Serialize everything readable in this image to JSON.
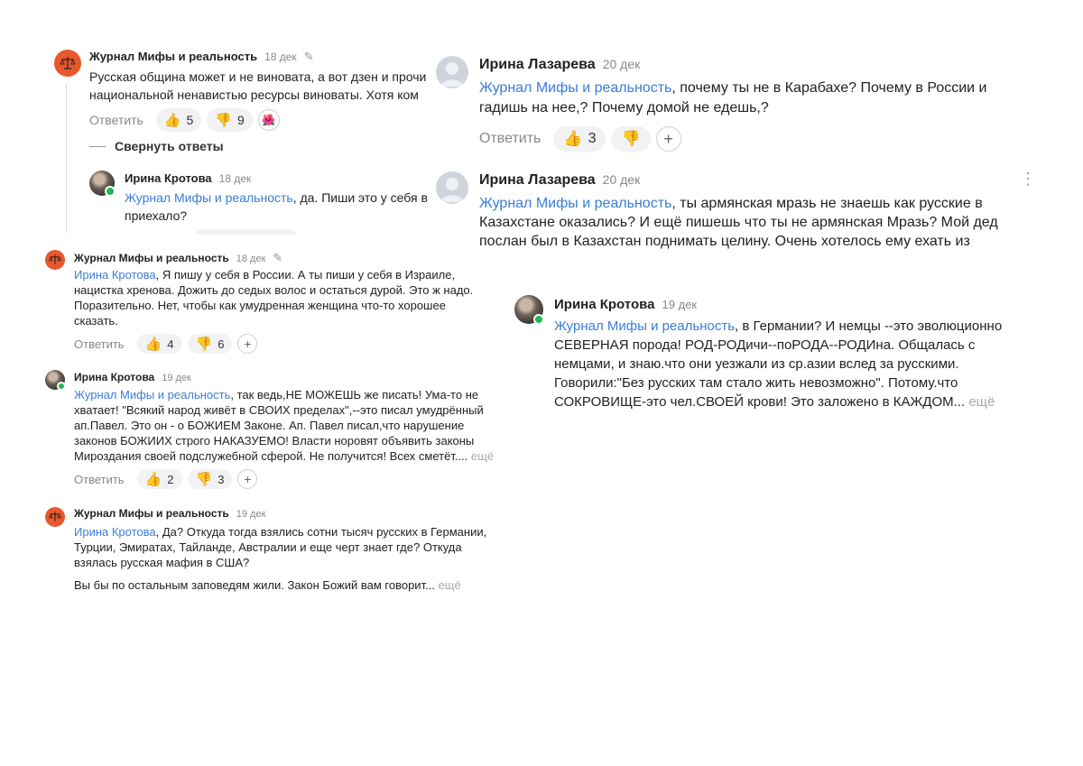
{
  "panel_a": {
    "c1": {
      "author": "Журнал Мифы и реальность",
      "date": "18 дек",
      "lines": [
        "Русская община может и не виновата, а вот дзен и прочи",
        "национальной ненавистью ресурсы виноваты. Хотя ком"
      ],
      "reply_label": "Ответить",
      "likes": "5",
      "dislikes": "9"
    },
    "collapse_label": "Свернуть ответы",
    "c2": {
      "author": "Ирина Кротова",
      "date": "18 дек",
      "mention": "Журнал Мифы и реальность",
      "text1": ", да. Пиши это у себя в",
      "line2": "приехало?"
    }
  },
  "panel_b": {
    "author": "Журнал Мифы и реальность",
    "date": "18 дек",
    "mention": "Ирина Кротова",
    "line1_rest": ", Я пишу у себя в России. А ты пиши у себя в Израиле,",
    "lines": [
      "нацистка хренова. Дожить до седых волос и остаться дурой. Это ж надо.",
      "Поразительно. Нет, чтобы как умудренная женщина что-то хорошее",
      "сказать."
    ],
    "reply_label": "Ответить",
    "likes": "4",
    "dislikes": "6"
  },
  "panel_c": {
    "author": "Ирина Кротова",
    "date": "19 дек",
    "mention": "Журнал Мифы и реальность",
    "line1_rest": ", так ведь,НЕ МОЖЕШЬ же писать! Ума-то не",
    "lines": [
      "хватает! \"Всякий народ живёт в СВОИХ пределах\",--это писал умудрённый",
      "ап.Павел. Это он - о БОЖИЕМ Законе. Ап. Павел писал,что нарушение",
      "законов БОЖИИХ строго НАКАЗУЕМО! Власти норовят объявить законы"
    ],
    "last_line": "Мироздания своей подслужебной сферой. Не получится! Всех сметёт....",
    "more": "ещё",
    "reply_label": "Ответить",
    "likes": "2",
    "dislikes": "3"
  },
  "panel_d": {
    "author": "Журнал Мифы и реальность",
    "date": "19 дек",
    "mention": "Ирина Кротова",
    "line1_rest": ", Да? Откуда тогда взялись сотни тысяч русских в Германии,",
    "lines": [
      "Турции, Эмиратах, Тайланде, Австралии и еще черт знает где? Откуда",
      "взялась русская мафия в США?"
    ],
    "para2": "Вы бы по остальным заповедям жили. Закон Божий вам говорит...",
    "more": "ещё"
  },
  "panel_e": {
    "c1": {
      "author": "Ирина Лазарева",
      "date": "20 дек",
      "mention": "Журнал Мифы и реальность",
      "line1_rest": ", почему ты не в Карабахе? Почему в России и",
      "line2": "гадишь на нее,? Почему домой не едешь,?",
      "reply_label": "Ответить",
      "likes": "3"
    },
    "c2": {
      "author": "Ирина Лазарева",
      "date": "20 дек",
      "mention": "Журнал Мифы и реальность",
      "line1_rest": ", ты армянская мразь не знаешь как русские в",
      "lines": [
        "Казахстане оказались? И ещё пишешь что ты не армянская Мразь? Мой дед",
        "послан был в Казахстан поднимать целину. Очень хотелось ему ехать из"
      ]
    }
  },
  "panel_f": {
    "author": "Ирина Кротова",
    "date": "19 дек",
    "mention": "Журнал Мифы и реальность",
    "line1_rest": ", в Германии? И немцы --это эволюционно",
    "lines": [
      "СЕВЕРНАЯ порода! РОД-РОДичи--поРОДА--РОДИна. Общалась с",
      "немцами, и знаю.что они уезжали из ср.азии вслед за русскими.",
      "Говорили:\"Без русских там стало жить невозможно\". Потому.что"
    ],
    "last_line": "СОКРОВИЩЕ-это чел.СВОЕЙ крови! Это заложено в КАЖДОМ...",
    "more": "ещё"
  },
  "colors": {
    "mention": "#3a7dd6",
    "journal_avatar": "#e8572e",
    "online": "#1db954"
  }
}
